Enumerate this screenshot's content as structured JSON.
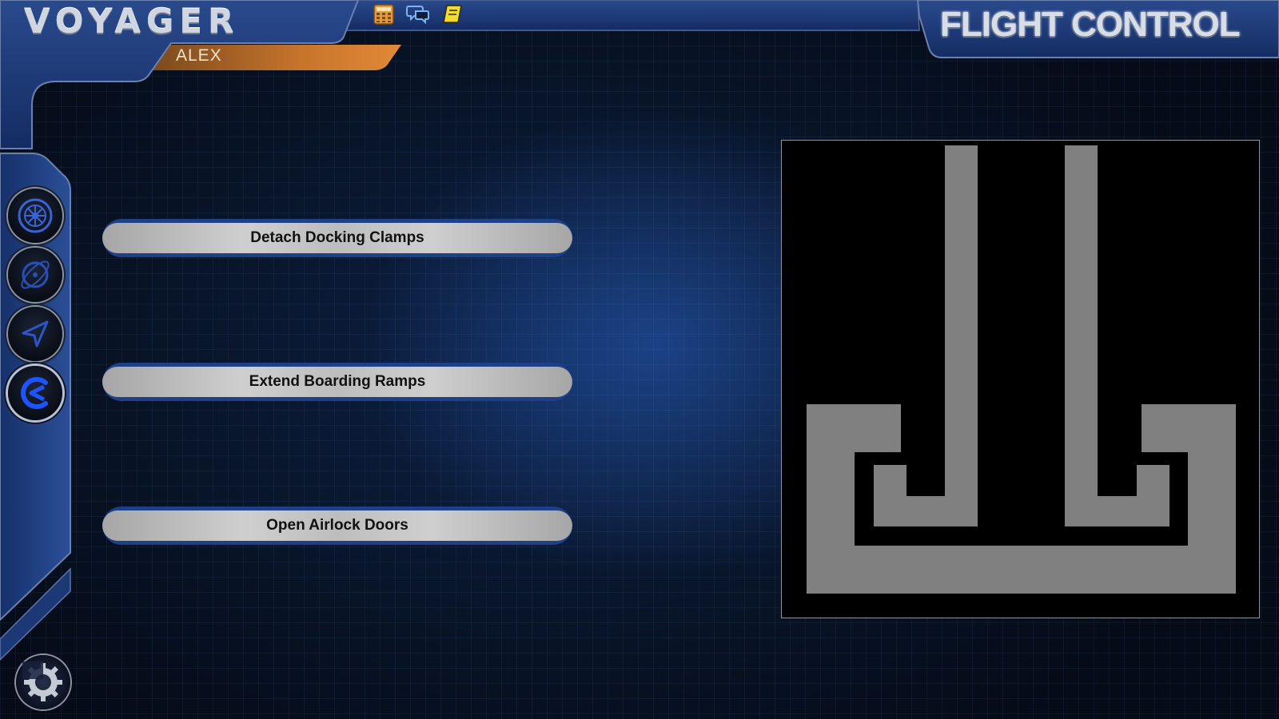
{
  "app": {
    "title": "VOYAGER",
    "user": "ALEX",
    "section_title": "FLIGHT CONTROL"
  },
  "toolbar": {
    "icons": [
      "calculator-icon",
      "chat-icon",
      "notebook-icon"
    ]
  },
  "sidebar": {
    "items": [
      {
        "icon": "engine-icon",
        "active": false
      },
      {
        "icon": "orbit-icon",
        "active": false
      },
      {
        "icon": "navigation-icon",
        "active": false
      },
      {
        "icon": "docking-icon",
        "active": true
      }
    ],
    "settings_icon": "gear-icon"
  },
  "actions": [
    {
      "label": "Detach Docking Clamps"
    },
    {
      "label": "Extend Boarding Ramps"
    },
    {
      "label": "Open Airlock Doors"
    }
  ],
  "colors": {
    "accent": "#1f3f86",
    "user_tab": "#d27a2c",
    "panel_gray": "#808080"
  }
}
